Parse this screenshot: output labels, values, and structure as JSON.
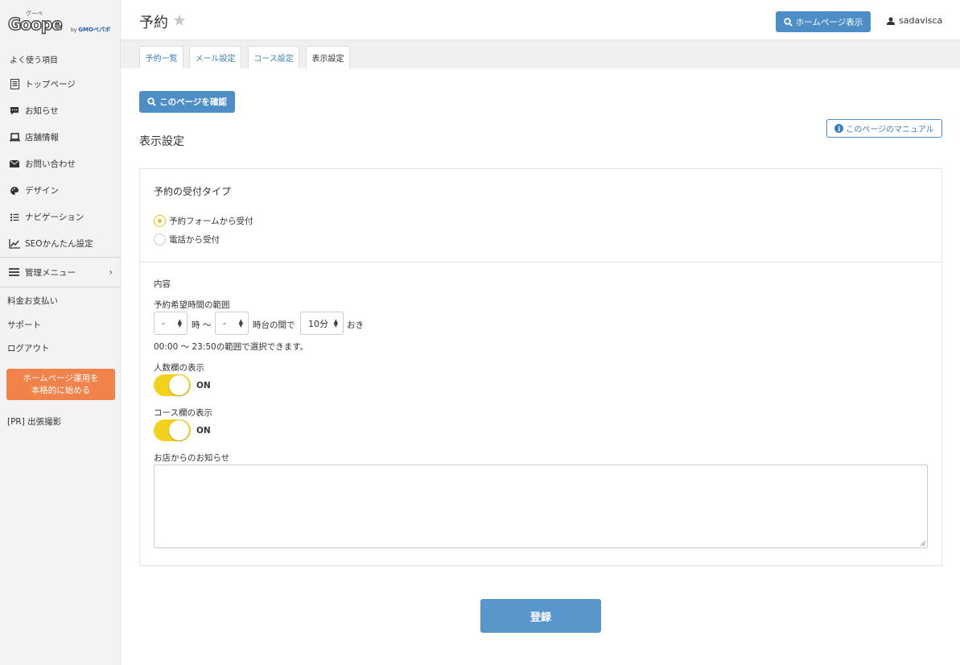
{
  "logo": {
    "wordmark": "Goope",
    "kana": "グーペ",
    "by": "by",
    "brand": "GMOペパボ"
  },
  "sidebar": {
    "section_label": "よく使う項目",
    "items": [
      {
        "label": "トップページ",
        "icon": "document-icon"
      },
      {
        "label": "お知らせ",
        "icon": "speech-bubble-icon"
      },
      {
        "label": "店舗情報",
        "icon": "laptop-icon"
      },
      {
        "label": "お問い合わせ",
        "icon": "envelope-icon"
      },
      {
        "label": "デザイン",
        "icon": "palette-icon"
      },
      {
        "label": "ナビゲーション",
        "icon": "list-icon"
      },
      {
        "label": "SEOかんたん設定",
        "icon": "chart-icon"
      }
    ],
    "management": {
      "label": "管理メニュー",
      "icon": "hamburger-icon"
    },
    "billing": "料金お支払い",
    "support": "サポート",
    "logout": "ログアウト",
    "promo_line1": "ホームページ運用を",
    "promo_line2": "本格的に始める",
    "pr": "[PR] 出張撮影"
  },
  "header": {
    "title": "予約",
    "star": "★",
    "homepage_button": "ホームページ表示",
    "username": "sadavisca"
  },
  "tabs": [
    {
      "label": "予約一覧"
    },
    {
      "label": "メール設定"
    },
    {
      "label": "コース設定"
    },
    {
      "label": "表示設定",
      "active": true
    }
  ],
  "content": {
    "confirm_button": "このページを確認",
    "manual_button": "このページのマニュアル",
    "section_title": "表示設定",
    "reception_type": {
      "heading": "予約の受付タイプ",
      "options": [
        "予約フォームから受付",
        "電話から受付"
      ],
      "selected": "予約フォームから受付"
    },
    "content_label": "内容",
    "time_range": {
      "label": "予約希望時間の範囲",
      "start_value": "-",
      "hour_text": "時 〜",
      "end_value": "-",
      "between_text": "時台の間で",
      "interval_value": "10分",
      "every_text": "おき",
      "note": "00:00 〜 23:50の範囲で選択できます。"
    },
    "people_field": {
      "label": "人数欄の表示",
      "state": "ON"
    },
    "course_field": {
      "label": "コース欄の表示",
      "state": "ON"
    },
    "notice": {
      "label": "お店からのお知らせ",
      "value": ""
    },
    "submit_button": "登録"
  },
  "colors": {
    "accent_blue": "#4e8ec7",
    "toggle_yellow": "#f2d21c",
    "promo_orange": "#f0824a"
  }
}
